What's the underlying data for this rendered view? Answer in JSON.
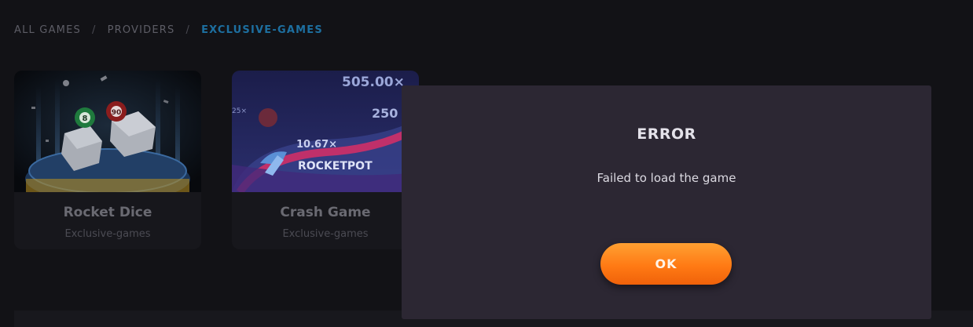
{
  "breadcrumb": {
    "items": [
      "ALL GAMES",
      "PROVIDERS",
      "EXCLUSIVE-GAMES"
    ],
    "separator": "/"
  },
  "games": [
    {
      "title": "Rocket Dice",
      "category": "Exclusive-games",
      "ball_green": "8",
      "ball_red": "90"
    },
    {
      "title": "Crash Game",
      "category": "Exclusive-games",
      "multiplier_top": "505.00×",
      "multiplier_right": "250",
      "multiplier_left": "25×",
      "multiplier_mid": "10.67×",
      "logo": "ROCKETPOT"
    }
  ],
  "modal": {
    "title": "ERROR",
    "message": "Failed to load the game",
    "ok_label": "OK"
  },
  "colors": {
    "background": "#121216",
    "modal_bg": "#2c2733",
    "breadcrumb_active": "#1d6fa0",
    "button_orange": "#ff7a14"
  }
}
